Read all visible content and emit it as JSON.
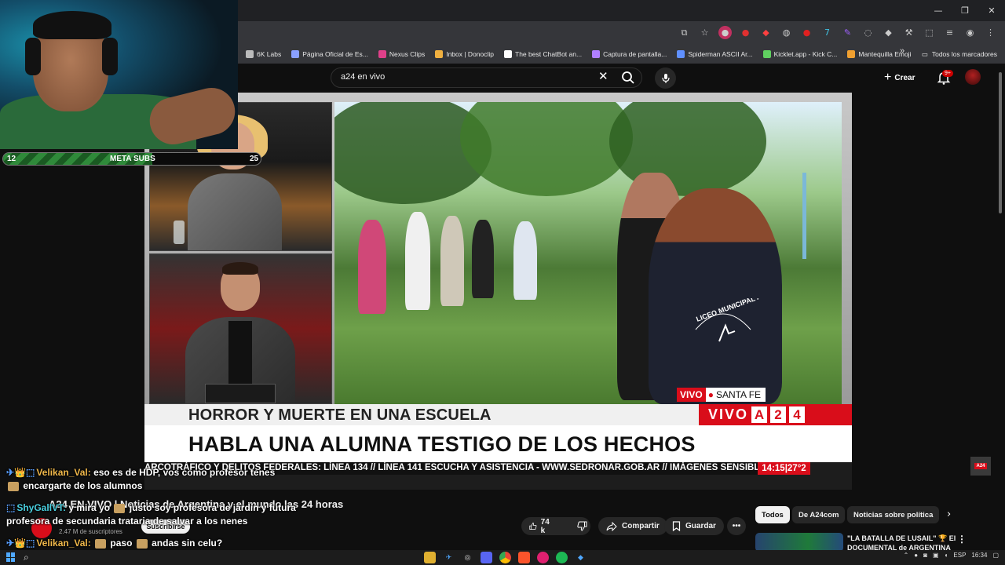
{
  "browser": {
    "window_controls": [
      "—",
      "❐",
      "✕"
    ],
    "bookmarks": [
      {
        "label": "6K Labs",
        "color": "#bbbbbb"
      },
      {
        "label": "Página Oficial de Es...",
        "color": "#8aa0ff"
      },
      {
        "label": "Nexus Clips",
        "color": "#e0408a"
      },
      {
        "label": "Inbox | Donoclip",
        "color": "#f0b040"
      },
      {
        "label": "The best ChatBot an...",
        "color": "#ffffff"
      },
      {
        "label": "Captura de pantalla...",
        "color": "#b080ff"
      },
      {
        "label": "Spiderman ASCII Ar...",
        "color": "#6090ff"
      },
      {
        "label": "Kicklet.app - Kick C...",
        "color": "#60d060"
      },
      {
        "label": "Mantequilla Emoji",
        "color": "#f0a030"
      }
    ],
    "bookmarks_more": "»",
    "all_bookmarks": "Todos los marcadores"
  },
  "youtube": {
    "search_query": "a24 en vivo",
    "create_label": "Crear",
    "notifications_badge": "9+",
    "video_title": "A24 EN VIVO | Noticias de Argentina y el mundo las 24 horas",
    "subscribers": "2.47 M de suscriptores",
    "subscribe_label": "Suscribirse",
    "likes": "74 k",
    "share_label": "Compartir",
    "save_label": "Guardar",
    "chips": [
      "Todos",
      "De A24com",
      "Noticias sobre política"
    ],
    "recommended_title": "\"LA BATALLA DE LUSAIL\" 🏆 El DOCUMENTAL de ARGENTINA"
  },
  "broadcast": {
    "live_label": "VIVO",
    "location": "SANTA FE",
    "headline_top": "HORROR Y MUERTE EN UNA ESCUELA",
    "brand_word": "VIVO",
    "brand_letters": [
      "A",
      "2",
      "4"
    ],
    "headline_main": "HABLA UNA ALUMNA TESTIGO DE LOS HECHOS",
    "ticker": "ARCOTRÁFICO Y DELITOS FEDERALES: LÍNEA 134 // LÍNEA 141 ESCUCHA Y ASISTENCIA - WWW.SEDRONAR.GOB.AR // IMÁGENES SENSIBLES.",
    "time_temp": "14:15|27°2",
    "shirt_text": "LICEO MUNICIPAL A. PERALTA PINO",
    "corner_logo": "A24"
  },
  "stream_overlay": {
    "meta_min": "12",
    "meta_label": "META SUBS",
    "meta_max": "25",
    "meta_progress": 0.58,
    "chat": [
      {
        "user": "Velikan_Val:",
        "text_before": "eso es de HDP, vos como profesor tenes",
        "text_after": "encargarte de los alumnos",
        "user_color": "#f0b84a"
      },
      {
        "user": "ShyGallVT:",
        "text_before": "y mira yo",
        "text_after": "justo soy profesora de jardín y futura profesora de secundaria trataria de salvar a los nenes",
        "user_color": "#4ad0e0"
      },
      {
        "user": "Velikan_Val:",
        "text_before": "paso",
        "text_after": "andas sin celu?",
        "user_color": "#f0b84a"
      }
    ]
  },
  "taskbar": {
    "language": "ESP",
    "time": "16:34"
  },
  "colors": {
    "a24_red": "#d90d1a",
    "yt_bg": "#0f0f0f"
  }
}
